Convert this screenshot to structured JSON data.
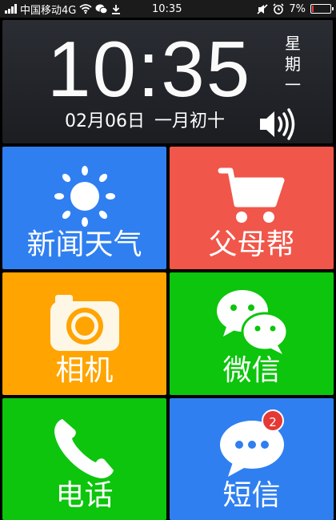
{
  "status_bar": {
    "carrier": "中国移动4G",
    "time": "10:35",
    "battery": "7%",
    "battery_level": 0.07,
    "icons": [
      "signal-icon",
      "wifi-icon",
      "wechat-icon",
      "download-icon",
      "mute-icon",
      "alarm-icon",
      "battery-icon"
    ]
  },
  "clock": {
    "time": "10:35",
    "weekday": [
      "星",
      "期",
      "一"
    ],
    "date": "02月06日",
    "lunar": "一月初十"
  },
  "tiles": [
    {
      "label": "新闻天气",
      "color": "#2f7ff0",
      "icon": "sun-icon"
    },
    {
      "label": "父母帮",
      "color": "#f0564a",
      "icon": "shopping-cart-icon"
    },
    {
      "label": "相机",
      "color": "#ffa400",
      "icon": "camera-icon"
    },
    {
      "label": "微信",
      "color": "#0cc50c",
      "icon": "wechat-icon"
    },
    {
      "label": "电话",
      "color": "#0cc50c",
      "icon": "phone-icon"
    },
    {
      "label": "短信",
      "color": "#2f7ff0",
      "icon": "message-icon",
      "badge": "2"
    }
  ]
}
